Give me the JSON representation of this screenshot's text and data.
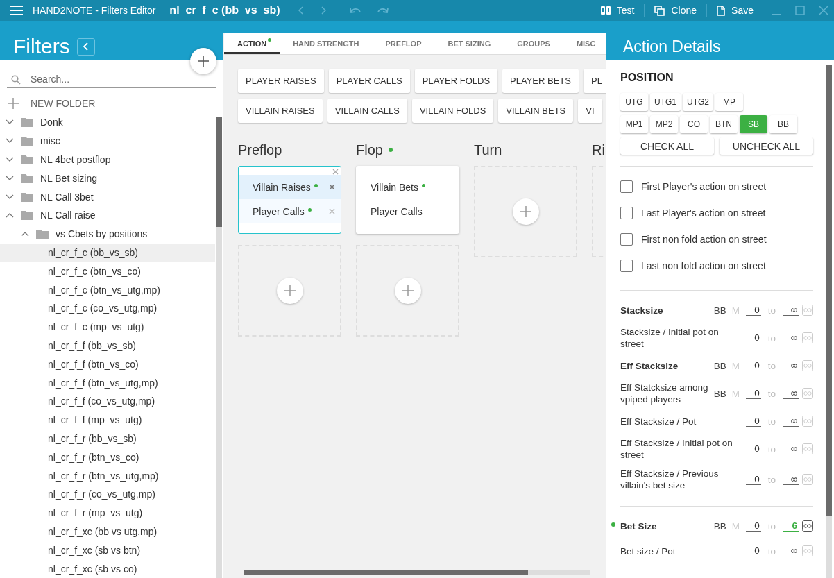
{
  "window": {
    "title": "HAND2NOTE - Filters Editor",
    "document": "nl_cr_f_c (bb_vs_sb)",
    "toolbar": [
      {
        "label": "Test",
        "kind": "test"
      },
      {
        "label": "Clone",
        "kind": "clone"
      },
      {
        "label": "Save",
        "kind": "save"
      }
    ]
  },
  "sidebar": {
    "title": "Filters",
    "search": {
      "placeholder": "Search..."
    },
    "new_folder": "NEW FOLDER",
    "tree": [
      {
        "label": "Donk",
        "kind": "folder",
        "expanded": false,
        "selected": false
      },
      {
        "label": "misc",
        "kind": "folder",
        "expanded": false,
        "selected": false
      },
      {
        "label": "NL 4bet postflop",
        "kind": "folder",
        "expanded": false,
        "selected": false
      },
      {
        "label": "NL Bet sizing",
        "kind": "folder",
        "expanded": false,
        "selected": false
      },
      {
        "label": "NL Call 3bet",
        "kind": "folder",
        "expanded": false,
        "selected": false
      },
      {
        "label": "NL Call raise",
        "kind": "folder",
        "expanded": true,
        "selected": false,
        "children": [
          {
            "label": "vs Cbets by positions",
            "kind": "folder",
            "expanded": true,
            "selected": false,
            "children": [
              {
                "label": "nl_cr_f_c (bb_vs_sb)",
                "kind": "filter",
                "selected": true
              },
              {
                "label": "nl_cr_f_c (btn_vs_co)",
                "kind": "filter",
                "selected": false
              },
              {
                "label": "nl_cr_f_c (btn_vs_utg,mp)",
                "kind": "filter",
                "selected": false
              },
              {
                "label": "nl_cr_f_c (co_vs_utg,mp)",
                "kind": "filter",
                "selected": false
              },
              {
                "label": "nl_cr_f_c (mp_vs_utg)",
                "kind": "filter",
                "selected": false
              },
              {
                "label": "nl_cr_f_f (bb_vs_sb)",
                "kind": "filter",
                "selected": false
              },
              {
                "label": "nl_cr_f_f (btn_vs_co)",
                "kind": "filter",
                "selected": false
              },
              {
                "label": "nl_cr_f_f (btn_vs_utg,mp)",
                "kind": "filter",
                "selected": false
              },
              {
                "label": "nl_cr_f_f (co_vs_utg,mp)",
                "kind": "filter",
                "selected": false
              },
              {
                "label": "nl_cr_f_f (mp_vs_utg)",
                "kind": "filter",
                "selected": false
              },
              {
                "label": "nl_cr_f_r (bb_vs_sb)",
                "kind": "filter",
                "selected": false
              },
              {
                "label": "nl_cr_f_r (btn_vs_co)",
                "kind": "filter",
                "selected": false
              },
              {
                "label": "nl_cr_f_r (btn_vs_utg,mp)",
                "kind": "filter",
                "selected": false
              },
              {
                "label": "nl_cr_f_r (co_vs_utg,mp)",
                "kind": "filter",
                "selected": false
              },
              {
                "label": "nl_cr_f_r (mp_vs_utg)",
                "kind": "filter",
                "selected": false
              },
              {
                "label": "nl_cr_f_xc (bb vs utg,mp)",
                "kind": "filter",
                "selected": false
              },
              {
                "label": "nl_cr_f_xc (sb vs btn)",
                "kind": "filter",
                "selected": false
              },
              {
                "label": "nl_cr_f_xc (sb vs co)",
                "kind": "filter",
                "selected": false
              }
            ]
          }
        ]
      }
    ]
  },
  "tabs": [
    {
      "label": "ACTION",
      "selected": true,
      "marked": true
    },
    {
      "label": "HAND STRENGTH",
      "selected": false
    },
    {
      "label": "PREFLOP",
      "selected": false
    },
    {
      "label": "BET SIZING",
      "selected": false
    },
    {
      "label": "GROUPS",
      "selected": false
    },
    {
      "label": "MISC",
      "selected": false
    }
  ],
  "action_buttons": [
    [
      "PLAYER RAISES",
      "PLAYER CALLS",
      "PLAYER FOLDS",
      "PLAYER BETS",
      "PL"
    ],
    [
      "VILLAIN RAISES",
      "VILLAIN CALLS",
      "VILLAIN FOLDS",
      "VILLAIN BETS",
      "VI"
    ]
  ],
  "streets": [
    {
      "name": "Preflop",
      "cards": [
        {
          "selected": true,
          "actions": [
            {
              "label": "Villain Raises",
              "marked": true,
              "linked": false,
              "selected": true
            },
            {
              "label": "Player Calls",
              "marked": true,
              "linked": true,
              "selected": false
            }
          ]
        }
      ]
    },
    {
      "name": "Flop",
      "marked": true,
      "cards": [
        {
          "selected": false,
          "actions": [
            {
              "label": "Villain Bets",
              "marked": true,
              "linked": false,
              "selected": false
            },
            {
              "label": "Player Calls",
              "marked": false,
              "linked": true,
              "selected": false
            }
          ]
        }
      ]
    },
    {
      "name": "Turn"
    },
    {
      "name": "Ri"
    }
  ],
  "details": {
    "title": "Action Details",
    "position_heading": "POSITION",
    "positions": [
      [
        {
          "label": "UTG",
          "selected": false
        },
        {
          "label": "UTG1",
          "selected": false
        },
        {
          "label": "UTG2",
          "selected": false
        },
        {
          "label": "MP",
          "selected": false
        }
      ],
      [
        {
          "label": "MP1",
          "selected": false
        },
        {
          "label": "MP2",
          "selected": false
        },
        {
          "label": "CO",
          "selected": false
        },
        {
          "label": "BTN",
          "selected": false
        },
        {
          "label": "SB",
          "selected": true
        },
        {
          "label": "BB",
          "selected": false
        }
      ]
    ],
    "check_all": "CHECK ALL",
    "uncheck_all": "UNCHECK ALL",
    "options": [
      {
        "label": "First Player's action on street",
        "checked": false
      },
      {
        "label": "Last Player's action on street",
        "checked": false
      },
      {
        "label": "First non fold action on street",
        "checked": false
      },
      {
        "label": "Last non fold action on street",
        "checked": false
      }
    ],
    "range_groups": [
      [
        {
          "label": "Stacksize",
          "bold": true,
          "units": [
            "BB",
            "M"
          ],
          "from": "0",
          "sep": "to",
          "to": "∞",
          "active": false
        },
        {
          "label": "Stacksize / Initial pot on street",
          "bold": false,
          "from": "0",
          "sep": "to",
          "to": "∞",
          "active": false
        },
        {
          "label": "Eff Stacksize",
          "bold": true,
          "units": [
            "BB",
            "M"
          ],
          "from": "0",
          "sep": "to",
          "to": "∞",
          "active": false
        },
        {
          "label": "Eff Statcksize among vpiped players",
          "bold": false,
          "units": [
            "BB",
            "M"
          ],
          "from": "0",
          "sep": "to",
          "to": "∞",
          "active": false
        },
        {
          "label": "Eff Stacksize / Pot",
          "bold": false,
          "from": "0",
          "sep": "to",
          "to": "∞",
          "active": false
        },
        {
          "label": "Eff Stacksize / Initial pot on street",
          "bold": false,
          "from": "0",
          "sep": "to",
          "to": "∞",
          "active": false
        },
        {
          "label": "Eff Stacksize / Previous villain's bet size",
          "bold": false,
          "from": "0",
          "sep": "to",
          "to": "∞",
          "active": false
        }
      ],
      [
        {
          "label": "Bet Size",
          "bold": true,
          "units": [
            "BB",
            "M"
          ],
          "from": "0",
          "sep": "to",
          "to": "6",
          "active": true
        },
        {
          "label": "Bet size / Pot",
          "bold": false,
          "from": "0",
          "sep": "to",
          "to": "∞",
          "active": false
        }
      ]
    ]
  }
}
